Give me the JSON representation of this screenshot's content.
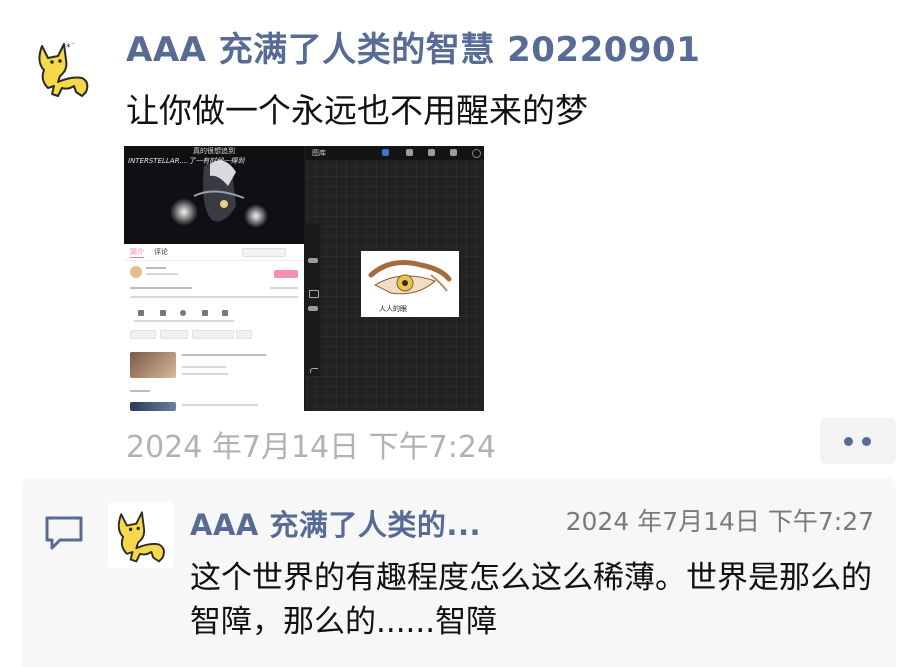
{
  "post": {
    "author": "AAA 充满了人类的智慧 20220901",
    "text": "让你做一个永远也不用醒来的梦",
    "time": "2024 年7月14日 下午7:24",
    "avatar_icon": "cat-avatar-icon",
    "more_icon": "more-dots-icon"
  },
  "image": {
    "video_title": "真的很想追到",
    "video_caption": "INTERSTELLAR....了一有时候一得到",
    "tab_intro": "简介",
    "tab_comments": "评论",
    "canvas_back": "图库",
    "drawing_label": "人人的眼"
  },
  "comment": {
    "icon": "comment-bubble-icon",
    "author": "AAA 充满了人类的...",
    "time": "2024 年7月14日 下午7:27",
    "text": "这个世界的有趣程度怎么这么稀薄。世界是那么的智障，那么的......智障"
  },
  "colors": {
    "author_blue": "#576b95",
    "timestamp_gray": "#b2b2b2",
    "comment_bg": "#f7f7f7",
    "cat_yellow": "#f5d94a"
  }
}
